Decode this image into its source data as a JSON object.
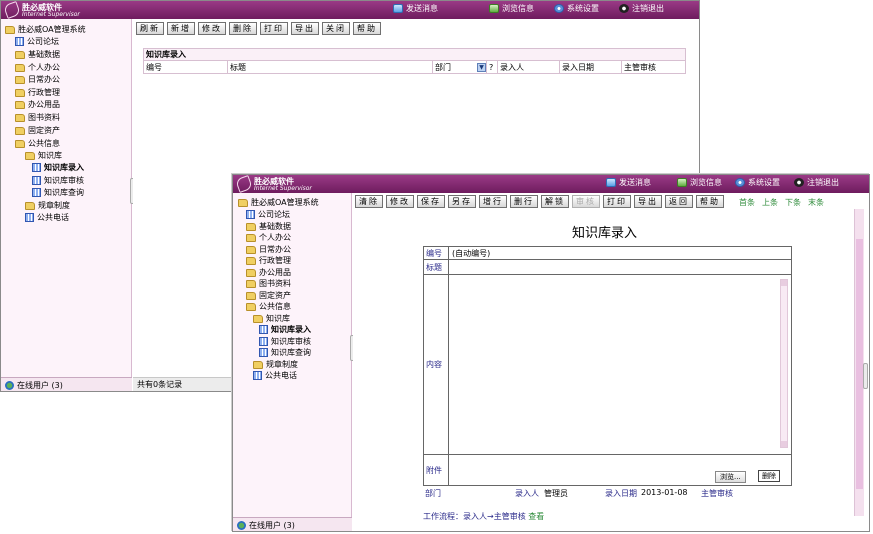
{
  "window1": {
    "header": {
      "logo_cn": "胜必威软件",
      "logo_en": "Internet Supervisor",
      "nav": [
        "发送消息",
        "浏览信息",
        "系统设置",
        "注销退出"
      ]
    },
    "tree": {
      "root": "胜必威OA管理系统",
      "items": [
        "公司论坛",
        "基础数据",
        "个人办公",
        "日常办公",
        "行政管理",
        "办公用品",
        "图书资料",
        "固定资产",
        "公共信息",
        "知识库",
        "知识库录入",
        "知识库审核",
        "知识库查询",
        "规章制度",
        "公共电话"
      ]
    },
    "toolbar": [
      "刷新",
      "新增",
      "修改",
      "删除",
      "打印",
      "导出",
      "关闭",
      "帮助"
    ],
    "list": {
      "title": "知识库录入",
      "columns": [
        "编号",
        "标题",
        "部门",
        "?",
        "录入人",
        "录入日期",
        "主管审核"
      ]
    },
    "online": "在线用户 (3)",
    "status": "共有0条记录"
  },
  "window2": {
    "header": {
      "logo_cn": "胜必威软件",
      "logo_en": "Internet Supervisor",
      "nav": [
        "发送消息",
        "浏览信息",
        "系统设置",
        "注销退出"
      ]
    },
    "tree": {
      "root": "胜必威OA管理系统",
      "items": [
        "公司论坛",
        "基础数据",
        "个人办公",
        "日常办公",
        "行政管理",
        "办公用品",
        "图书资料",
        "固定资产",
        "公共信息",
        "知识库",
        "知识库录入",
        "知识库审核",
        "知识库查询",
        "规章制度",
        "公共电话"
      ]
    },
    "toolbar": [
      "清除",
      "修改",
      "保存",
      "另存",
      "增行",
      "删行",
      "解锁",
      "审核",
      "打印",
      "导出",
      "返回",
      "帮助"
    ],
    "navlinks": [
      "首条",
      "上条",
      "下条",
      "末条"
    ],
    "form": {
      "title": "知识库录入",
      "fields": {
        "id_label": "编号",
        "id_value": "(自动编号)",
        "title_label": "标题",
        "content_label": "内容",
        "attachment_label": "附件",
        "browse": "浏览...",
        "delete": "删除"
      },
      "meta": {
        "dept_label": "部门",
        "entry_label": "录入人",
        "entry_value": "管理员",
        "date_label": "录入日期",
        "date_value": "2013-01-08",
        "review_label": "主管审核"
      },
      "workflow_label": "工作流程：录入人→主管审核",
      "workflow_link": "查看"
    },
    "online": "在线用户 (3)"
  }
}
